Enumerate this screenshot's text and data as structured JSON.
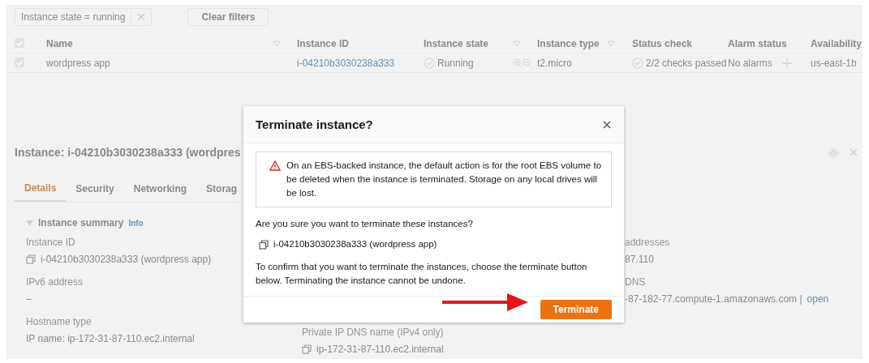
{
  "filter_bar": {
    "token": "Instance state = running",
    "clear_button": "Clear filters"
  },
  "table": {
    "select_all_checked": true,
    "columns": [
      {
        "label": "Name",
        "kind": "filter"
      },
      {
        "label": "Instance ID",
        "kind": "plain"
      },
      {
        "label": "Instance state",
        "kind": "filter"
      },
      {
        "label": "Instance type",
        "kind": "filter"
      },
      {
        "label": "Status check",
        "kind": "plain"
      },
      {
        "label": "Alarm status",
        "kind": "plain"
      },
      {
        "label": "Availability",
        "kind": "plain"
      }
    ],
    "rows": [
      {
        "selected": true,
        "name": "wordpress app",
        "instance_id": "i-04210b3030238a333",
        "state": "Running",
        "type": "t2.micro",
        "status_check": "2/2 checks passed",
        "alarm_status": "No alarms",
        "zone": "us-east-1b"
      }
    ]
  },
  "details": {
    "title": "Instance: i-04210b3030238a333 (wordpres",
    "tabs": [
      {
        "label": "Details",
        "selected": true
      },
      {
        "label": "Security",
        "selected": false
      },
      {
        "label": "Networking",
        "selected": false
      },
      {
        "label": "Storag",
        "selected": false
      }
    ],
    "section": {
      "title": "Instance summary",
      "expanded": true,
      "info": "Info"
    },
    "field_columns": [
      [
        {
          "label": "Instance ID",
          "value": "i-04210b3030238a333 (wordpress app)",
          "kind": "copy"
        },
        {
          "label": "IPv6 address",
          "value": "–",
          "kind": "text"
        },
        {
          "label": "Hostname type",
          "value": "IP name: ip-172-31-87-110.ec2.internal",
          "kind": "text"
        }
      ],
      [
        {
          "label": "Private IP DNS name (IPv4 only)",
          "value": "ip-172-31-87-110.ec2.internal",
          "kind": "copy"
        }
      ],
      [
        {
          "label": "addresses",
          "value": "87.110",
          "kind": "text"
        },
        {
          "label": "DNS",
          "value": "-87-182-77.compute-1.amazonaws.com |",
          "link": "open",
          "kind": "text"
        }
      ]
    ]
  },
  "modal": {
    "title": "Terminate instance?",
    "warning": "On an EBS-backed instance, the default action is for the root EBS volume to be deleted when the instance is terminated. Storage on any local drives will be lost.",
    "question": "Are you sure you want to terminate these instances?",
    "instances": [
      "i-04210b3030238a333 (wordpress app)"
    ],
    "confirm_text": "To confirm that you want to terminate the instances, choose the terminate button below. Terminating the instance cannot be undone.",
    "primary_button": "Terminate"
  }
}
